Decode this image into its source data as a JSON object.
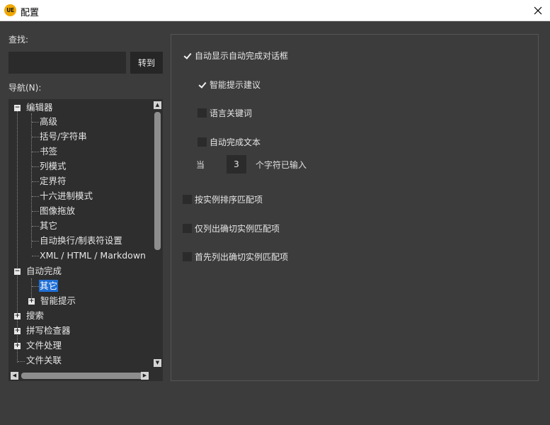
{
  "window": {
    "title": "配置",
    "logo_text": "UE",
    "close_glyph": "✕"
  },
  "search": {
    "label": "查找:",
    "value": "",
    "placeholder": "",
    "goto_button": "转到"
  },
  "navigation": {
    "label": "导航(N):",
    "tree": [
      {
        "label": "编辑器",
        "level": 0,
        "toggle": "minus"
      },
      {
        "label": "高级",
        "level": 1
      },
      {
        "label": "括号/字符串",
        "level": 1
      },
      {
        "label": "书签",
        "level": 1
      },
      {
        "label": "列模式",
        "level": 1
      },
      {
        "label": "定界符",
        "level": 1
      },
      {
        "label": "十六进制模式",
        "level": 1
      },
      {
        "label": "图像拖放",
        "level": 1
      },
      {
        "label": "其它",
        "level": 1
      },
      {
        "label": "自动换行/制表符设置",
        "level": 1
      },
      {
        "label": "XML / HTML / Markdown",
        "level": 1
      },
      {
        "label": "自动完成",
        "level": 0,
        "toggle": "minus"
      },
      {
        "label": "其它",
        "level": 1,
        "selected": true
      },
      {
        "label": "智能提示",
        "level": 1,
        "toggle": "plus"
      },
      {
        "label": "搜索",
        "level": 0,
        "toggle": "plus"
      },
      {
        "label": "拼写检查器",
        "level": 0,
        "toggle": "plus"
      },
      {
        "label": "文件处理",
        "level": 0,
        "toggle": "plus"
      },
      {
        "label": "文件关联",
        "level": 0
      }
    ]
  },
  "options": {
    "show_autocomplete_dialog": {
      "label": "自动显示自动完成对话框",
      "checked": true
    },
    "smart_hint_suggestions": {
      "label": "智能提示建议",
      "checked": true
    },
    "language_keywords": {
      "label": "语言关键词",
      "checked": false
    },
    "autocomplete_text": {
      "label": "自动完成文本",
      "checked": false
    },
    "threshold_prefix": "当",
    "threshold_value": "3",
    "threshold_suffix": "个字符已输入",
    "sort_by_instance": {
      "label": "按实例排序匹配项",
      "checked": false
    },
    "list_exact_only": {
      "label": "仅列出确切实例匹配项",
      "checked": false
    },
    "list_exact_first": {
      "label": "首先列出确切实例匹配项",
      "checked": false
    }
  },
  "colors": {
    "selection": "#1f6fd6",
    "background": "#3c3c3c",
    "logo": "#f0a800"
  }
}
